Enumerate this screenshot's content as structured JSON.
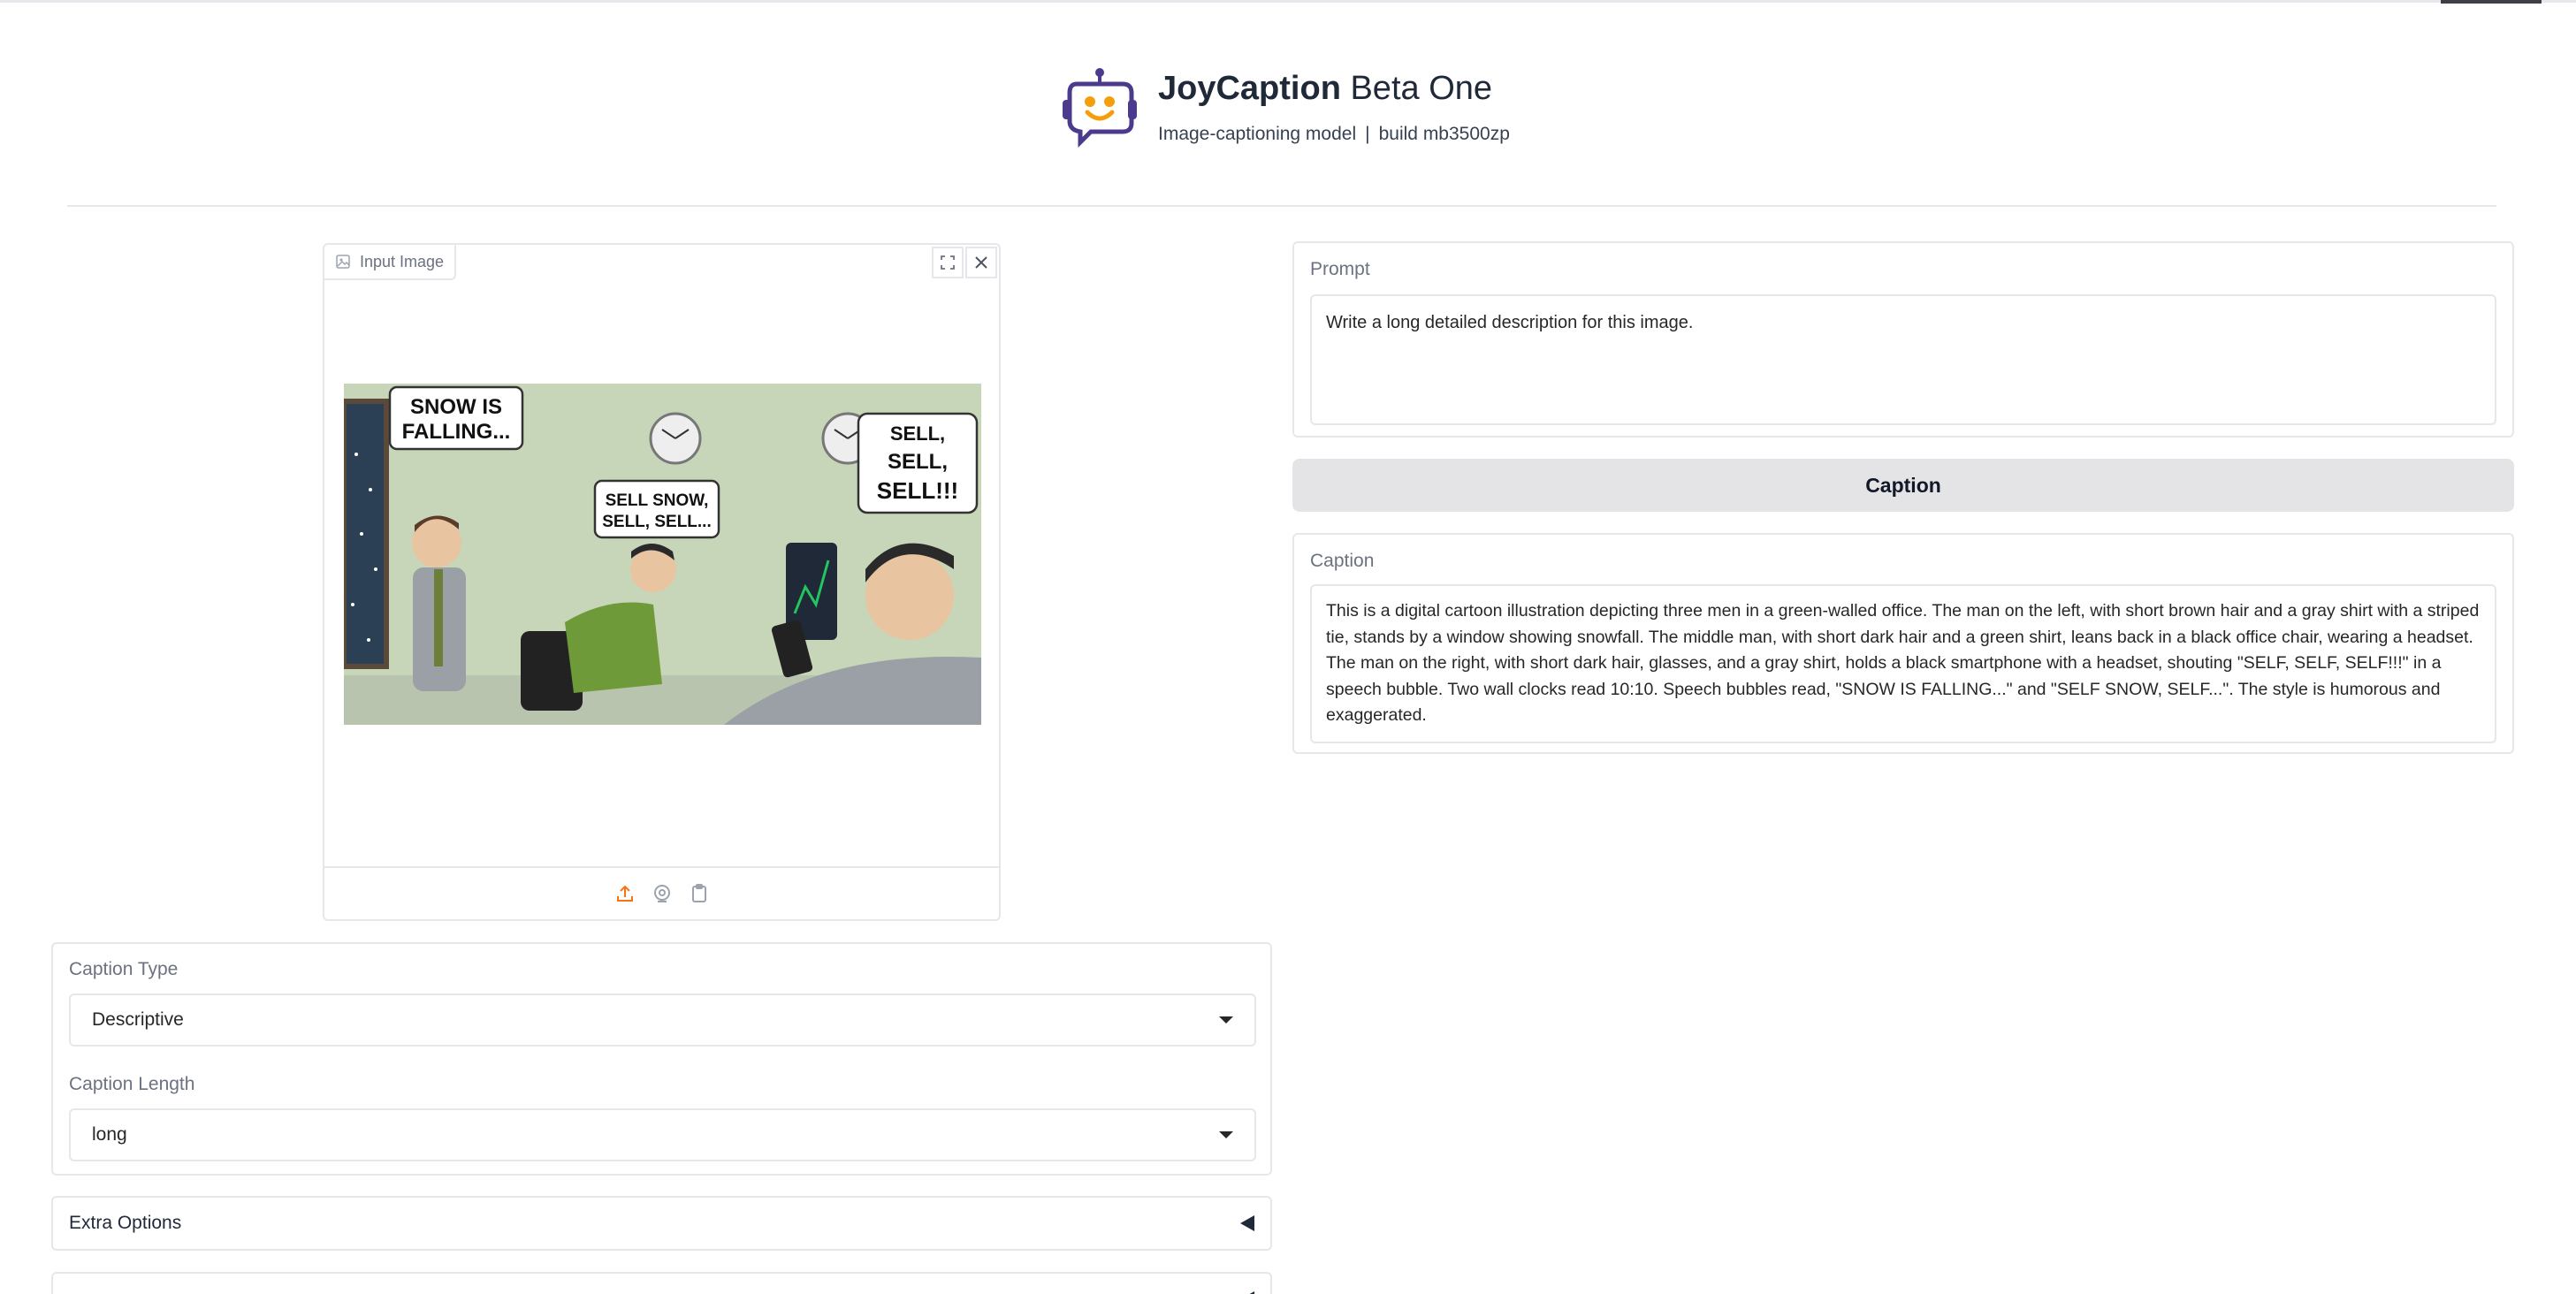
{
  "header": {
    "title_bold": "JoyCaption",
    "title_light": " Beta One",
    "subtitle_left": "Image-captioning model",
    "subtitle_sep": "|",
    "subtitle_right": "build mb3500zp"
  },
  "input_image": {
    "label": "Input Image",
    "bubbles": {
      "left": [
        "SNOW IS",
        "FALLING..."
      ],
      "middle": [
        "SELL SNOW,",
        "SELL, SELL..."
      ],
      "right": [
        "SELL,",
        "SELL,",
        "SELL!!!"
      ]
    }
  },
  "prompt": {
    "label": "Prompt",
    "value": "Write a long detailed description for this image."
  },
  "caption_button": "Caption",
  "caption": {
    "label": "Caption",
    "value": "This is a digital cartoon illustration depicting three men in a green-walled office. The man on the left, with short brown hair and a gray shirt with a striped tie, stands by a window showing snowfall. The middle man, with short dark hair and a green shirt, leans back in a black office chair, wearing a headset. The man on the right, with short dark hair, glasses, and a gray shirt, holds a black smartphone with a headset, shouting \"SELF, SELF, SELF!!!\" in a speech bubble. Two wall clocks read 10:10. Speech bubbles read, \"SNOW IS FALLING...\" and \"SELF SNOW, SELF...\". The style is humorous and exaggerated."
  },
  "settings": {
    "caption_type_label": "Caption Type",
    "caption_type_value": "Descriptive",
    "caption_length_label": "Caption Length",
    "caption_length_value": "long"
  },
  "accordions": {
    "extra_options": "Extra Options"
  },
  "colors": {
    "accent": "#f97316",
    "logo_purple": "#4c3a8c",
    "logo_face": "#f59e0b",
    "office_wall": "#c7d6b8"
  }
}
